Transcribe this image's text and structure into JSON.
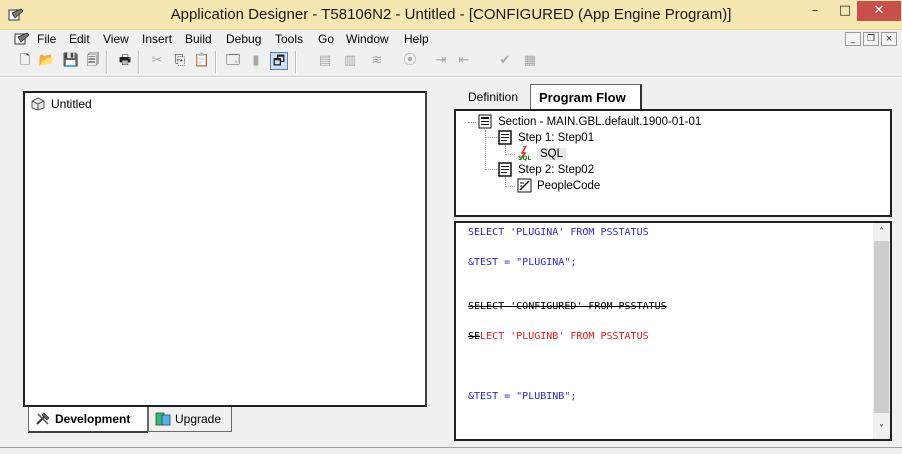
{
  "window": {
    "title": "Application Designer - T58106N2 - Untitled - [CONFIGURED (App Engine Program)]",
    "controls": {
      "minimize": "–",
      "maximize": "□",
      "close": "✕"
    },
    "colors": {
      "titlebar": "#f5e6b2",
      "close": "#c7504a"
    }
  },
  "menubar": {
    "items": [
      "File",
      "Edit",
      "View",
      "Insert",
      "Build",
      "Debug",
      "Tools",
      "Go",
      "Window",
      "Help"
    ],
    "mdi_controls": {
      "minimize": "_",
      "restore": "❐",
      "close": "×"
    }
  },
  "toolbar": {
    "buttons": [
      {
        "name": "new-icon",
        "glyph": "🗋"
      },
      {
        "name": "open-icon",
        "glyph": "📂"
      },
      {
        "name": "save-icon",
        "glyph": "💾"
      },
      {
        "name": "save-all-icon",
        "glyph": "🗐"
      },
      {
        "name": "print-icon",
        "glyph": "🖶"
      },
      {
        "name": "cut-icon",
        "glyph": "✂"
      },
      {
        "name": "copy-icon",
        "glyph": "⎘"
      },
      {
        "name": "paste-icon",
        "glyph": "📋"
      },
      {
        "name": "properties-icon",
        "glyph": "🗔"
      },
      {
        "name": "object-icon",
        "glyph": "▮"
      },
      {
        "name": "project-workspace-icon",
        "glyph": "🗗"
      },
      {
        "name": "build-icon",
        "glyph": "▤"
      },
      {
        "name": "compile-icon",
        "glyph": "▥"
      },
      {
        "name": "sql-icon",
        "glyph": "≋"
      },
      {
        "name": "find-icon",
        "glyph": "⦿"
      },
      {
        "name": "insert-step-icon",
        "glyph": "⇥"
      },
      {
        "name": "insert-action-icon",
        "glyph": "⇤"
      },
      {
        "name": "validate-icon",
        "glyph": "✔"
      },
      {
        "name": "run-icon",
        "glyph": "▦"
      }
    ]
  },
  "left_pane": {
    "root_label": "Untitled",
    "tabs": [
      "Development",
      "Upgrade"
    ]
  },
  "right_pane": {
    "tabs": [
      "Definition",
      "Program Flow"
    ],
    "flow": {
      "section": "Section - MAIN.GBL.default.1900-01-01",
      "step1": "Step 1: Step01",
      "sql": "SQL",
      "step2": "Step 2: Step02",
      "peoplecode": "PeopleCode"
    },
    "code": {
      "line1": "SELECT 'PLUGINA' FROM PSSTATUS",
      "line2": "&TEST = \"PLUGINA\";",
      "line3": "SELECT 'CONFIGURED' FROM PSSTATUS",
      "line4_prefix": "SE",
      "line4_rest": "LECT 'PLUGINB' FROM PSSTATUS",
      "line5": "&TEST = \"PLUBINB\";"
    },
    "scroll": {
      "up": "˄",
      "down": "˅"
    }
  }
}
